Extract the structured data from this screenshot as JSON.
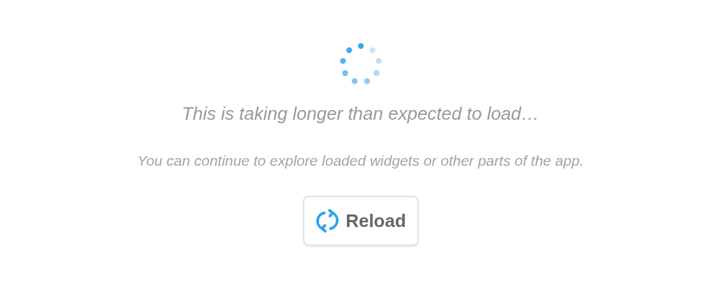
{
  "message": {
    "title": "This is taking longer than expected to load…",
    "subtitle": "You can continue to explore loaded widgets or other parts of the app."
  },
  "button": {
    "label": "Reload"
  }
}
